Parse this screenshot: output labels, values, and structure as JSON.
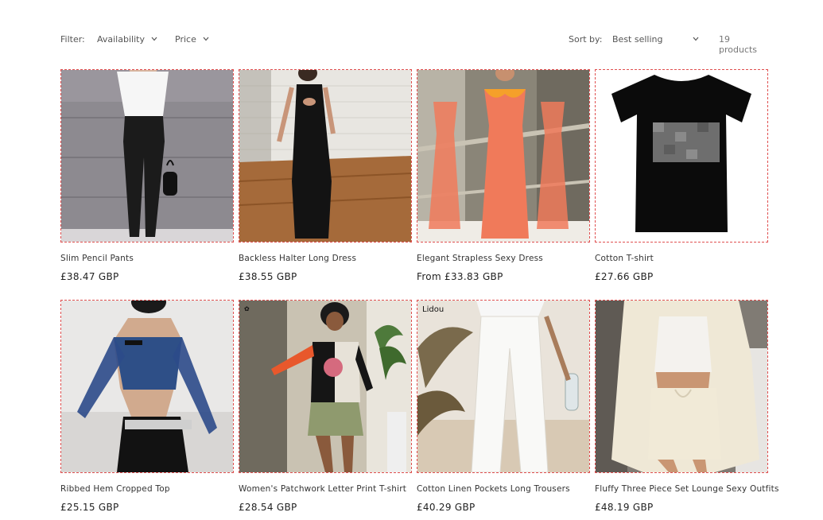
{
  "filter": {
    "label": "Filter:",
    "availability": "Availability",
    "price": "Price"
  },
  "sort": {
    "label": "Sort by:",
    "selected": "Best selling",
    "count": "19 products"
  },
  "products": [
    {
      "title": "Slim Pencil Pants",
      "price": "£38.47 GBP"
    },
    {
      "title": "Backless Halter Long Dress",
      "price": "£38.55 GBP"
    },
    {
      "title": "Elegant Strapless Sexy Dress",
      "price": "From £33.83 GBP"
    },
    {
      "title": "Cotton T-shirt",
      "price": "£27.66 GBP"
    },
    {
      "title": "Ribbed Hem Cropped Top",
      "price": "£25.15 GBP"
    },
    {
      "title": "Women's Patchwork Letter Print T-shirt",
      "price": "£28.54 GBP"
    },
    {
      "title": "Cotton Linen Pockets Long Trousers",
      "price": "£40.29 GBP",
      "brand": "Lidou"
    },
    {
      "title": "Fluffy Three Piece Set Lounge Sexy Outfits",
      "price": "£48.19 GBP"
    }
  ],
  "colors": {
    "card_border": "#e05050",
    "text": "#121212"
  }
}
